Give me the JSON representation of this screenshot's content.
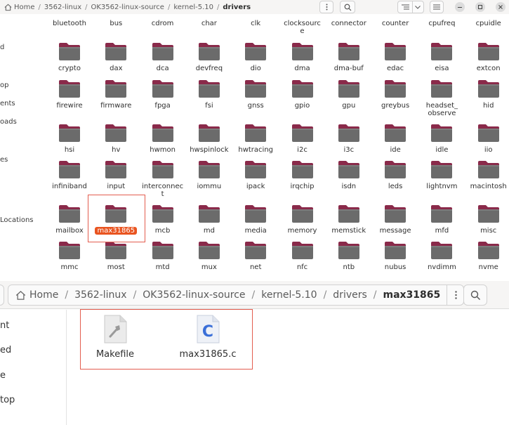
{
  "top_window": {
    "breadcrumb": [
      "Home",
      "3562-linux",
      "OK3562-linux-source",
      "kernel-5.10",
      "drivers"
    ],
    "sidebar_items": [
      "d",
      "op",
      "ents",
      "oads",
      "es",
      "Locations"
    ],
    "first_row_labels": [
      "bluetooth",
      "bus",
      "cdrom",
      "char",
      "clk",
      "clocksourc\ne",
      "connector",
      "counter",
      "cpufreq",
      "cpuidle"
    ],
    "folder_rows": [
      [
        "crypto",
        "dax",
        "dca",
        "devfreq",
        "dio",
        "dma",
        "dma-buf",
        "edac",
        "eisa",
        "extcon"
      ],
      [
        "firewire",
        "firmware",
        "fpga",
        "fsi",
        "gnss",
        "gpio",
        "gpu",
        "greybus",
        "headset_\nobserve",
        "hid"
      ],
      [
        "hsi",
        "hv",
        "hwmon",
        "hwspinlock",
        "hwtracing",
        "i2c",
        "i3c",
        "ide",
        "idle",
        "iio"
      ],
      [
        "infiniband",
        "input",
        "interconnec\nt",
        "iommu",
        "ipack",
        "irqchip",
        "isdn",
        "leds",
        "lightnvm",
        "macintosh"
      ],
      [
        "mailbox",
        "max31865",
        "mcb",
        "md",
        "media",
        "memory",
        "memstick",
        "message",
        "mfd",
        "misc"
      ],
      [
        "mmc",
        "most",
        "mtd",
        "mux",
        "net",
        "nfc",
        "ntb",
        "nubus",
        "nvdimm",
        "nvme"
      ]
    ],
    "selected_folder": "max31865"
  },
  "bottom_window": {
    "breadcrumb": [
      "Home",
      "3562-linux",
      "OK3562-linux-source",
      "kernel-5.10",
      "drivers",
      "max31865"
    ],
    "sidebar_items": [
      "nt",
      "ed",
      "e",
      "top"
    ],
    "files": [
      {
        "name": "Makefile",
        "icon": "makefile-icon"
      },
      {
        "name": "max31865.c",
        "icon": "c-source-file-icon",
        "glyph": "C"
      }
    ]
  },
  "colors": {
    "accent": "#e95420",
    "highlight_box": "#e35d4f",
    "folder_body": "#6b6b6b",
    "folder_tab": "#8a2a4a"
  }
}
